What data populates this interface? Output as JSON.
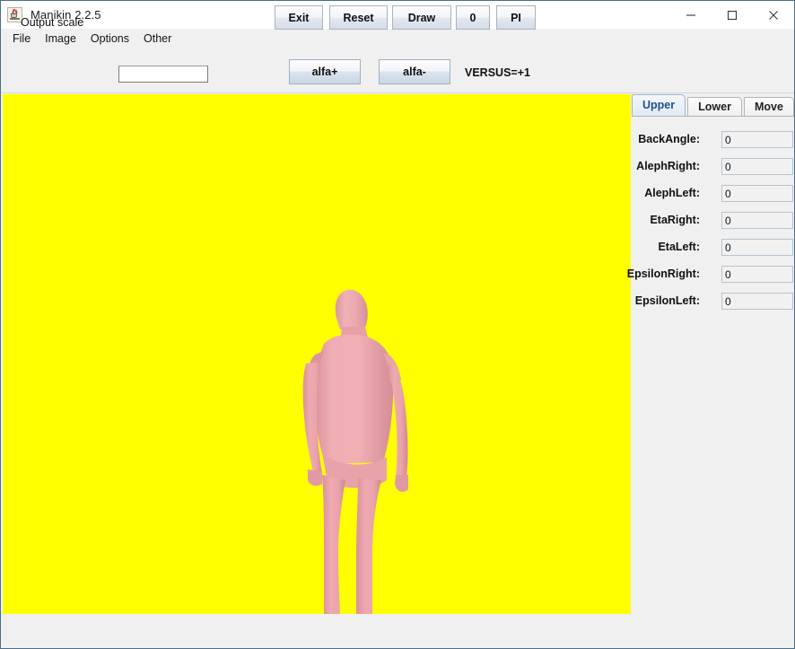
{
  "window": {
    "title": "Manikin 2.2.5",
    "icon": "java-coffee-cup-icon",
    "controls": {
      "minimize": "minimize-icon",
      "maximize": "maximize-icon",
      "close": "close-icon"
    }
  },
  "menu": {
    "items": [
      {
        "label": "File"
      },
      {
        "label": "Image"
      },
      {
        "label": "Options"
      },
      {
        "label": "Other"
      }
    ]
  },
  "toolbar": {
    "output_scale_label": "Output scale",
    "output_scale_value": "",
    "output_scale_placeholder": "",
    "alfa_plus_label": "alfa+",
    "alfa_minus_label": "alfa-",
    "versus_label": "VERSUS=+1"
  },
  "viewport": {
    "background_color": "#ffff00",
    "figure_color": "#eda7ad",
    "figure_shade_color": "#d98f98",
    "figure_highlight_color": "#f3bcc0",
    "description": "3D rendered manikin human figure, rear view, standing"
  },
  "side_panel": {
    "tabs": [
      {
        "label": "Upper",
        "selected": true
      },
      {
        "label": "Lower",
        "selected": false
      },
      {
        "label": "Move",
        "selected": false
      }
    ],
    "fields": [
      {
        "label": "BackAngle:",
        "value": "0"
      },
      {
        "label": "AlephRight:",
        "value": "0"
      },
      {
        "label": "AlephLeft:",
        "value": "0"
      },
      {
        "label": "EtaRight:",
        "value": "0"
      },
      {
        "label": "EtaLeft:",
        "value": "0"
      },
      {
        "label": "EpsilonRight:",
        "value": "0"
      },
      {
        "label": "EpsilonLeft:",
        "value": "0"
      }
    ]
  },
  "bottom_bar": {
    "buttons": [
      {
        "label": "Exit"
      },
      {
        "label": "Reset"
      },
      {
        "label": "Draw"
      },
      {
        "label": "0"
      },
      {
        "label": "PI"
      }
    ]
  }
}
